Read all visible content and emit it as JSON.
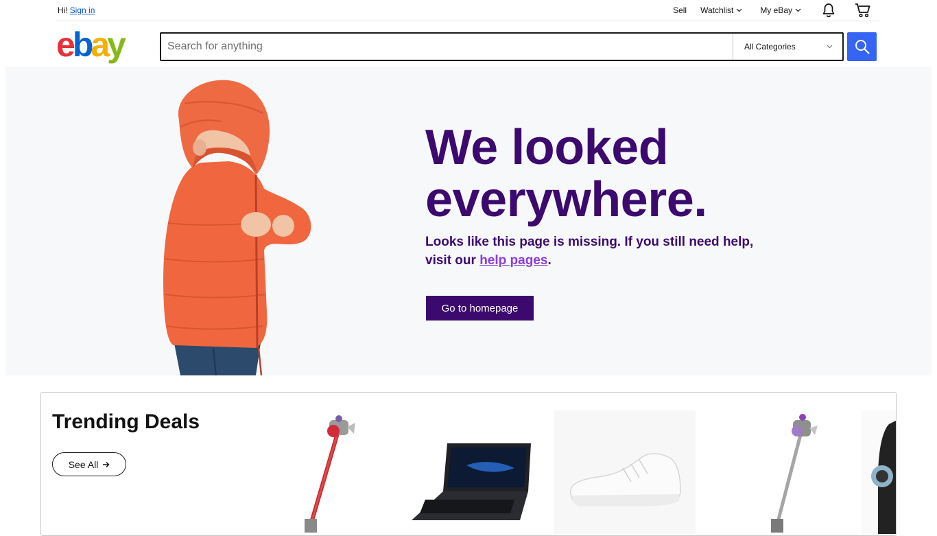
{
  "topbar": {
    "greeting": "Hi!",
    "signin_link": "Sign in",
    "sell": "Sell",
    "watchlist": "Watchlist",
    "myebay": "My eBay"
  },
  "header": {
    "logo_letters": [
      "e",
      "b",
      "a",
      "y"
    ],
    "search_placeholder": "Search for anything",
    "category_selected": "All Categories"
  },
  "hero": {
    "title_line1": "We looked",
    "title_line2": "everywhere.",
    "message": "Looks like this page is missing. If you still need help,",
    "message_line2_prefix": "visit our",
    "help_link": "help pages",
    "message_suffix": ".",
    "homepage_button": "Go to homepage"
  },
  "trending": {
    "title": "Trending Deals",
    "see_all": "See All",
    "items": [
      "stick-vacuum",
      "gaming-laptop",
      "white-sneaker",
      "stick-vacuum",
      "partial-item"
    ]
  },
  "colors": {
    "accent_blue": "#3665f3",
    "hero_purple": "#3c0a6e",
    "link_purple": "#8b3dd6",
    "logo_red": "#e53238",
    "logo_blue": "#0064d2",
    "logo_yellow": "#f5af02",
    "logo_green": "#86b817"
  }
}
